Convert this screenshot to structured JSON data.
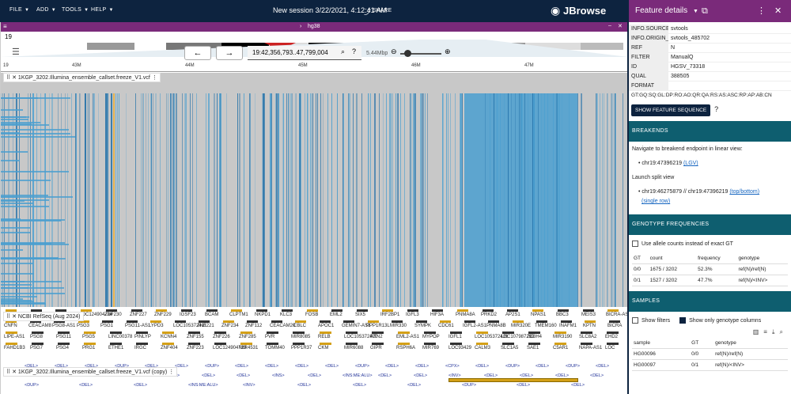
{
  "menu": {
    "file": "FILE",
    "add": "ADD",
    "tools": "TOOLS",
    "help": "HELP"
  },
  "session": "New session 3/22/2021, 4:12:41 AM",
  "share": "SHARE",
  "logo": "JBrowse",
  "assembly": "hg38",
  "chrom": "19",
  "locstring": "19:42,356,793..47,799,004",
  "span": "5.44Mbp",
  "ticks": [
    "43M",
    "44M",
    "45M",
    "46M",
    "47M"
  ],
  "tracks": {
    "vcf": "1KGP_3202.Illumina_ensemble_callset.freeze_V1.vcf",
    "refseq": "NCBI RefSeq (Aug 2024)",
    "vcfcopy": "1KGP_3202.Illumina_ensemble_callset.freeze_V1.vcf (copy)"
  },
  "colors": {
    "accent": "#0d233f",
    "purple": "#7a2a7a",
    "teal": "#0e5e6f",
    "heat": "#4a9fd0"
  },
  "genes": {
    "row1": [
      "LOC112",
      "LOC284344",
      "PHLDB3",
      "LOC124904724",
      "ZNF230",
      "ZNF227",
      "ZNF229",
      "IGSF23",
      "BCAM",
      "CLPTM1",
      "NKPD1",
      "KLC3",
      "FOSB",
      "EML2",
      "SIX5",
      "IRF2BP1",
      "IGFL3",
      "HIF3A",
      "PNMA8A",
      "PRKD2",
      "AP2S1",
      "NPAS1",
      "BBC3",
      "MEIS3",
      "BICRA-AS2"
    ],
    "row2": [
      "CNFN",
      "CEACAM8",
      "PSG8-AS1",
      "PSG3",
      "PSG1",
      "PSG11-AS1",
      "LYPD3",
      "LOC105372411",
      "ZNF221",
      "ZNF234",
      "ZNF112",
      "CEACAM20",
      "CBLC",
      "APOC1",
      "GEMIN7-AS1",
      "PPP1R13L",
      "MIR330",
      "SYMPK",
      "CDC61",
      "IGFL2-AS1",
      "PNMA8B",
      "MIR320E",
      "TMEM160",
      "INAFM1",
      "KPTN",
      "BICRA"
    ],
    "row3": [
      "LIPE-AS1",
      "PSG8",
      "PSG11",
      "PSG5",
      "LINC00378",
      "PINLYP",
      "KCNN4",
      "ZNF155",
      "ZNF226",
      "ZNF285",
      "PVR",
      "MIR8085",
      "RELB",
      "LOC105372420",
      "RTN2",
      "EML2-AS1",
      "MYPOP",
      "IGFL1",
      "LOC105372426",
      "LOC107987269",
      "ZC3H4",
      "MIR3190",
      "SLC8A2",
      "EHD2"
    ],
    "row4": [
      "FAHD1B3",
      "PSG7",
      "PSG4",
      "PRG1",
      "ETHE1",
      "IRGC",
      "ZNF404",
      "ZNF223",
      "LOC124904723",
      "MIR4531",
      "TOMM40",
      "PPP1R37",
      "CKM",
      "MIR6088",
      "GIPR",
      "RSPH6A",
      "MIR769",
      "LOC93429",
      "CALM3",
      "SLC1A5",
      "SAE1",
      "C5AR1",
      "NAPA-AS1",
      "LOC"
    ]
  },
  "sv": {
    "row1": [
      "<DEL>",
      "<DEL>",
      "<DEL>",
      "<DUP>",
      "<DEL>",
      "<DEL>",
      "<DUP>",
      "<DEL>",
      "<DEL>",
      "<DEL>",
      "<DEL>",
      "<DUP>",
      "<DEL>",
      "<DEL>",
      "<CPX>",
      "<DEL>",
      "<DUP>",
      "<DEL>",
      "<DUP>",
      "<DEL>"
    ],
    "row2": [
      "<DEL>",
      "<DEL>",
      "<DUP>",
      "<DUP>",
      "<DEL>",
      "<DEL>",
      "<DEL>",
      "<INS>",
      "<DEL>",
      "<INS:ME:ALU>",
      "<DEL>",
      "<DEL>",
      "<INV>",
      "<DEL>",
      "<DEL>",
      "<DEL>",
      "<DEL>"
    ],
    "row3": [
      "<DUP>",
      "<DEL>",
      "<DEL>",
      "<INS:ME:ALU>",
      "<INV>",
      "<DEL>",
      "<DEL>",
      "<DEL>",
      "<DUP>",
      "<DEL>",
      "<DEL>"
    ]
  },
  "fd": {
    "title": "Feature details",
    "fields": [
      [
        "INFO.SOURCE",
        "svtools"
      ],
      [
        "INFO.ORIGIN_SVID",
        "svtools_485702"
      ],
      [
        "REF",
        "N"
      ],
      [
        "FILTER",
        "ManualQ"
      ],
      [
        "ID",
        "HGSV_73318"
      ],
      [
        "QUAL",
        "388505"
      ],
      [
        "FORMAT",
        ""
      ]
    ],
    "format": "GT:GQ:SQ:GL:DP:RO:AO:QR:QA:RS:AS:ASC:RP:AP:AB:CN",
    "showseq": "SHOW FEATURE SEQUENCE",
    "breakends": "BREAKENDS",
    "navtext": "Navigate to breakend endpoint in linear view:",
    "bp1": "chr19:47396219",
    "lgv": "(LGV)",
    "launch": "Launch split view",
    "bp2": "chr19:46275879 // chr19:47396219",
    "topbottom": "(top/bottom)",
    "singlerow": "(single row)",
    "gtfreq": "GENOTYPE FREQUENCIES",
    "useallele": "Use allele counts instead of exact GT",
    "gthead": [
      "GT",
      "count",
      "frequency",
      "genotype"
    ],
    "gtrows": [
      [
        "0/0",
        "1675 / 3202",
        "52.3%",
        "ref(N)/ref(N)"
      ],
      [
        "0/1",
        "1527 / 3202",
        "47.7%",
        "ref(N)/<INV>"
      ]
    ],
    "samples": "SAMPLES",
    "showfilters": "Show filters",
    "showonlygt": "Show only genotype columns",
    "shead": [
      "sample",
      "GT",
      "genotype"
    ],
    "srows": [
      [
        "HG00096",
        "0/0",
        "ref(N)/ref(N)"
      ],
      [
        "HG00097",
        "0/1",
        "ref(N)/<INV>"
      ]
    ]
  }
}
